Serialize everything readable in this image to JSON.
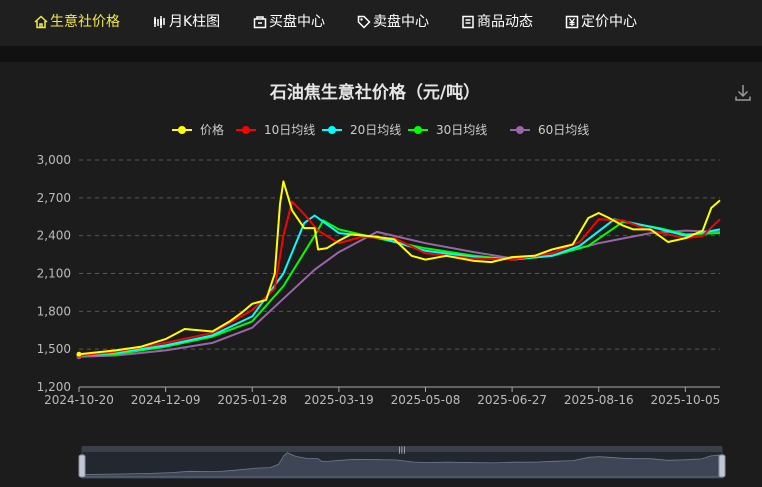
{
  "nav": {
    "items": [
      {
        "label": "生意社价格",
        "icon": "home-icon",
        "active": true
      },
      {
        "label": "月K柱图",
        "icon": "candlestick-icon",
        "active": false
      },
      {
        "label": "买盘中心",
        "icon": "cart-icon",
        "active": false
      },
      {
        "label": "卖盘中心",
        "icon": "tag-icon",
        "active": false
      },
      {
        "label": "商品动态",
        "icon": "document-icon",
        "active": false
      },
      {
        "label": "定价中心",
        "icon": "yen-icon",
        "active": false
      }
    ],
    "active_color": "#f1e84a"
  },
  "toolbox": {
    "download_icon": "download-icon"
  },
  "chart_data": {
    "type": "line",
    "title": "石油焦生意社价格（元/吨）",
    "xlabel": "",
    "ylabel": "",
    "ylim": [
      1200,
      3000
    ],
    "yticks": [
      "1,200",
      "1,500",
      "1,800",
      "2,100",
      "2,400",
      "2,700",
      "3,000"
    ],
    "xticks": [
      "2024-10-20",
      "2024-12-09",
      "2025-01-28",
      "2025-03-19",
      "2025-05-08",
      "2025-06-27",
      "2025-08-16",
      "2025-10-05"
    ],
    "x_range": [
      "2024-10-20",
      "2025-10-25"
    ],
    "grid": "horizontal-dashed",
    "legend_position": "top-center",
    "series": [
      {
        "name": "价格",
        "color": "#ffff00",
        "points": [
          [
            "2024-10-20",
            1460
          ],
          [
            "2024-11-10",
            1490
          ],
          [
            "2024-11-25",
            1520
          ],
          [
            "2024-12-09",
            1580
          ],
          [
            "2024-12-20",
            1660
          ],
          [
            "2025-01-05",
            1640
          ],
          [
            "2025-01-15",
            1720
          ],
          [
            "2025-01-22",
            1790
          ],
          [
            "2025-01-28",
            1860
          ],
          [
            "2025-02-05",
            1890
          ],
          [
            "2025-02-10",
            2100
          ],
          [
            "2025-02-13",
            2650
          ],
          [
            "2025-02-15",
            2830
          ],
          [
            "2025-02-20",
            2600
          ],
          [
            "2025-02-27",
            2460
          ],
          [
            "2025-03-05",
            2460
          ],
          [
            "2025-03-07",
            2290
          ],
          [
            "2025-03-12",
            2300
          ],
          [
            "2025-03-19",
            2360
          ],
          [
            "2025-03-26",
            2410
          ],
          [
            "2025-04-10",
            2390
          ],
          [
            "2025-04-20",
            2370
          ],
          [
            "2025-04-30",
            2240
          ],
          [
            "2025-05-08",
            2210
          ],
          [
            "2025-05-20",
            2240
          ],
          [
            "2025-06-05",
            2200
          ],
          [
            "2025-06-15",
            2190
          ],
          [
            "2025-06-27",
            2230
          ],
          [
            "2025-07-10",
            2240
          ],
          [
            "2025-07-20",
            2290
          ],
          [
            "2025-08-01",
            2330
          ],
          [
            "2025-08-10",
            2540
          ],
          [
            "2025-08-16",
            2580
          ],
          [
            "2025-08-22",
            2540
          ],
          [
            "2025-08-30",
            2480
          ],
          [
            "2025-09-05",
            2450
          ],
          [
            "2025-09-15",
            2450
          ],
          [
            "2025-09-25",
            2350
          ],
          [
            "2025-10-05",
            2380
          ],
          [
            "2025-10-15",
            2440
          ],
          [
            "2025-10-20",
            2620
          ],
          [
            "2025-10-25",
            2680
          ]
        ]
      },
      {
        "name": "10日均线",
        "color": "#ff0000",
        "points": [
          [
            "2024-10-20",
            1450
          ],
          [
            "2024-11-10",
            1480
          ],
          [
            "2024-12-09",
            1550
          ],
          [
            "2025-01-05",
            1630
          ],
          [
            "2025-01-28",
            1810
          ],
          [
            "2025-02-10",
            1980
          ],
          [
            "2025-02-15",
            2400
          ],
          [
            "2025-02-20",
            2670
          ],
          [
            "2025-02-27",
            2570
          ],
          [
            "2025-03-07",
            2440
          ],
          [
            "2025-03-19",
            2340
          ],
          [
            "2025-04-01",
            2390
          ],
          [
            "2025-04-20",
            2380
          ],
          [
            "2025-05-08",
            2260
          ],
          [
            "2025-06-05",
            2220
          ],
          [
            "2025-06-27",
            2210
          ],
          [
            "2025-07-20",
            2260
          ],
          [
            "2025-08-05",
            2350
          ],
          [
            "2025-08-16",
            2530
          ],
          [
            "2025-08-30",
            2520
          ],
          [
            "2025-09-15",
            2440
          ],
          [
            "2025-10-05",
            2380
          ],
          [
            "2025-10-15",
            2400
          ],
          [
            "2025-10-25",
            2530
          ]
        ]
      },
      {
        "name": "20日均线",
        "color": "#00ffff",
        "points": [
          [
            "2024-10-20",
            1450
          ],
          [
            "2024-11-10",
            1470
          ],
          [
            "2024-12-09",
            1530
          ],
          [
            "2025-01-05",
            1610
          ],
          [
            "2025-01-28",
            1760
          ],
          [
            "2025-02-15",
            2100
          ],
          [
            "2025-02-27",
            2500
          ],
          [
            "2025-03-05",
            2560
          ],
          [
            "2025-03-19",
            2420
          ],
          [
            "2025-04-10",
            2390
          ],
          [
            "2025-05-08",
            2280
          ],
          [
            "2025-06-05",
            2230
          ],
          [
            "2025-06-27",
            2210
          ],
          [
            "2025-07-20",
            2240
          ],
          [
            "2025-08-05",
            2320
          ],
          [
            "2025-08-25",
            2530
          ],
          [
            "2025-09-15",
            2470
          ],
          [
            "2025-10-05",
            2400
          ],
          [
            "2025-10-25",
            2450
          ]
        ]
      },
      {
        "name": "30日均线",
        "color": "#00ff00",
        "points": [
          [
            "2024-10-20",
            1450
          ],
          [
            "2024-11-10",
            1460
          ],
          [
            "2024-12-09",
            1520
          ],
          [
            "2025-01-05",
            1600
          ],
          [
            "2025-01-28",
            1720
          ],
          [
            "2025-02-15",
            2000
          ],
          [
            "2025-03-05",
            2400
          ],
          [
            "2025-03-10",
            2520
          ],
          [
            "2025-03-19",
            2450
          ],
          [
            "2025-04-10",
            2380
          ],
          [
            "2025-05-08",
            2300
          ],
          [
            "2025-06-05",
            2240
          ],
          [
            "2025-06-27",
            2210
          ],
          [
            "2025-07-20",
            2240
          ],
          [
            "2025-08-10",
            2320
          ],
          [
            "2025-08-30",
            2510
          ],
          [
            "2025-09-20",
            2460
          ],
          [
            "2025-10-05",
            2410
          ],
          [
            "2025-10-25",
            2420
          ]
        ]
      },
      {
        "name": "60日均线",
        "color": "#9966aa",
        "points": [
          [
            "2024-10-20",
            1440
          ],
          [
            "2024-11-10",
            1450
          ],
          [
            "2024-12-09",
            1490
          ],
          [
            "2025-01-05",
            1550
          ],
          [
            "2025-01-28",
            1670
          ],
          [
            "2025-02-15",
            1900
          ],
          [
            "2025-03-05",
            2130
          ],
          [
            "2025-03-19",
            2270
          ],
          [
            "2025-04-10",
            2430
          ],
          [
            "2025-05-08",
            2340
          ],
          [
            "2025-06-05",
            2270
          ],
          [
            "2025-06-27",
            2220
          ],
          [
            "2025-07-20",
            2240
          ],
          [
            "2025-08-16",
            2340
          ],
          [
            "2025-09-15",
            2420
          ],
          [
            "2025-10-05",
            2440
          ],
          [
            "2025-10-25",
            2430
          ]
        ]
      }
    ]
  }
}
